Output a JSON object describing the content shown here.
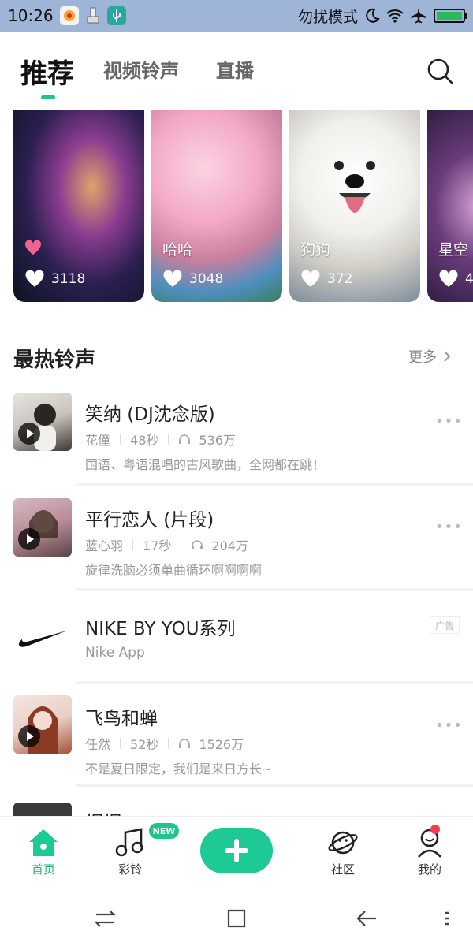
{
  "status_bar": {
    "time": "10:26",
    "dnd_label": "勿扰模式"
  },
  "tabs": [
    {
      "label": "推荐",
      "active": true
    },
    {
      "label": "视频铃声",
      "active": false
    },
    {
      "label": "直播",
      "active": false
    }
  ],
  "cards": [
    {
      "title": "",
      "likes": "3118"
    },
    {
      "title": "哈哈",
      "likes": "3048"
    },
    {
      "title": "狗狗",
      "likes": "372"
    },
    {
      "title": "星空",
      "likes": "4"
    }
  ],
  "hot_section": {
    "title": "最热铃声",
    "more": "更多"
  },
  "songs": [
    {
      "title": "笑纳 (DJ沈念版)",
      "artist": "花僮",
      "duration": "48秒",
      "plays": "536万",
      "desc": "国语、粤语混唱的古风歌曲，全网都在跳！"
    },
    {
      "title": "平行恋人 (片段)",
      "artist": "蓝心羽",
      "duration": "17秒",
      "plays": "204万",
      "desc": "旋律洗脑必须单曲循环啊啊啊啊"
    },
    {
      "title": "飞鸟和蝉",
      "artist": "任然",
      "duration": "52秒",
      "plays": "1526万",
      "desc": "不是夏日限定，我们是来日方长~"
    },
    {
      "title": "桐桐"
    }
  ],
  "ad": {
    "title": "NIKE BY YOU系列",
    "subtitle": "Nike App",
    "badge": "广告"
  },
  "bottom_nav": {
    "home": "首页",
    "ringtone": "彩铃",
    "new_badge": "NEW",
    "community": "社区",
    "mine": "我的"
  },
  "colors": {
    "accent": "#20c38b",
    "status_bar": "#9eb5d8"
  }
}
